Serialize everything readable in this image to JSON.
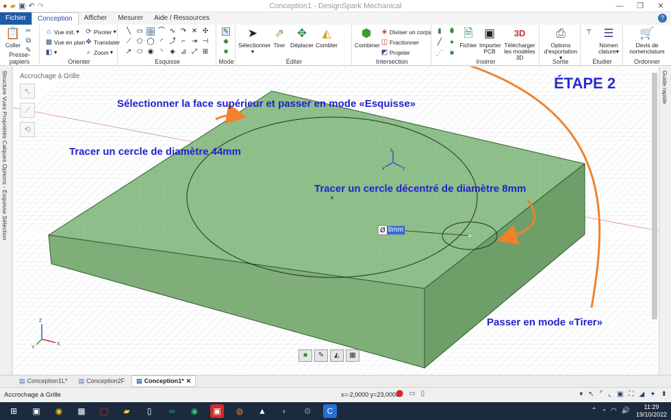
{
  "titlebar": {
    "title": "Conception1 - DesignSpark Mechanical",
    "quick_access": [
      "app-menu",
      "open",
      "save",
      "undo",
      "redo"
    ]
  },
  "tabs": [
    "Fichier",
    "Conception",
    "Afficher",
    "Mesurer",
    "Aide / Ressources"
  ],
  "active_tab": "Conception",
  "ribbon": {
    "presse_papiers": {
      "label": "Presse-papiers",
      "coller": "Coller"
    },
    "orienter": {
      "label": "Orienter",
      "vue_init": "Vue init.",
      "pivoter": "Pivoter",
      "vue_en_plan": "Vue en plan",
      "translater": "Translater",
      "zoom": "Zoom"
    },
    "esquisse": {
      "label": "Esquisse"
    },
    "mode": {
      "label": "Mode"
    },
    "editer": {
      "label": "Éditer",
      "selectionner": "Sélectionner",
      "tirer": "Tirer",
      "deplacer": "Déplacer",
      "combler": "Combler"
    },
    "intersection": {
      "label": "Intersection",
      "combiner": "Combiner",
      "diviser": "Diviser un corps",
      "fractionner": "Fractionner",
      "projeter": "Projeter"
    },
    "inserer": {
      "label": "Insérer",
      "fichier": "Fichier",
      "importer_pcb": "Importer PCB",
      "telecharger": "Télécharger les modèles 3D"
    },
    "sortie": {
      "label": "Sortie",
      "options": "Options d'exportation"
    },
    "etudier": {
      "label": "Étudier",
      "nomenclature": "Nomen clature"
    },
    "ordonner": {
      "label": "Ordonner",
      "devis": "Devis de nomenclature"
    }
  },
  "left_panel_text": "Structure Vues Propriétés Calques Options - Esquisse Sélection",
  "right_panel_text": "Guide rapide",
  "viewport": {
    "snap_label": "Accrochage à Grille",
    "etape": "ÉTAPE 2",
    "annotations": {
      "select_face": "Sélectionner la face supérieur et passer en mode «Esquisse»",
      "circle_44": "Tracer un cercle de diamètre 44mm",
      "circle_8": "Tracer un cercle décentré de diamètre 8mm",
      "tirer": "Passer en mode «Tirer»"
    },
    "dimension": {
      "symbol": "Ø",
      "value": "8mm"
    }
  },
  "doc_tabs": [
    {
      "label": "Conception1L*",
      "active": false
    },
    {
      "label": "Conception2F",
      "active": false
    },
    {
      "label": "Conception1*",
      "active": true
    }
  ],
  "status": {
    "left": "Accrochage à Grille",
    "coords": "x=-2,0000  y=23,0000"
  },
  "clock": {
    "time": "11:29",
    "date": "19/10/2022"
  },
  "colors": {
    "annotation": "#2222cc",
    "arrow": "#f0822a",
    "plate": "#8fbf8a",
    "file_tab": "#1e5aa8"
  }
}
